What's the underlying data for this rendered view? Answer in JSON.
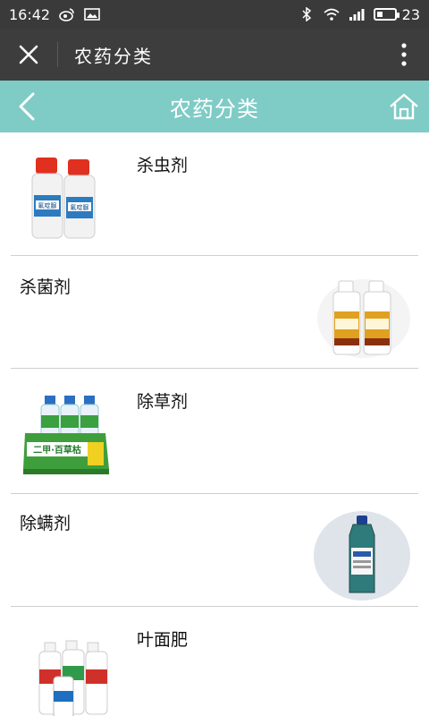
{
  "statusbar": {
    "time": "16:42",
    "battery": "23"
  },
  "titlebar": {
    "title": "农药分类"
  },
  "header": {
    "title": "农药分类"
  },
  "categories": [
    {
      "label": "杀虫剂"
    },
    {
      "label": "杀菌剂"
    },
    {
      "label": "除草剂"
    },
    {
      "label": "除螨剂"
    },
    {
      "label": "叶面肥"
    }
  ],
  "product_text": {
    "insecticide": "氟啶脲",
    "herbicide": "二甲·百草枯"
  },
  "colors": {
    "statusbar": "#3a3a3a",
    "titlebar": "#3d3d3d",
    "header": "#7fcbc6",
    "divider": "#cfcfcf"
  }
}
